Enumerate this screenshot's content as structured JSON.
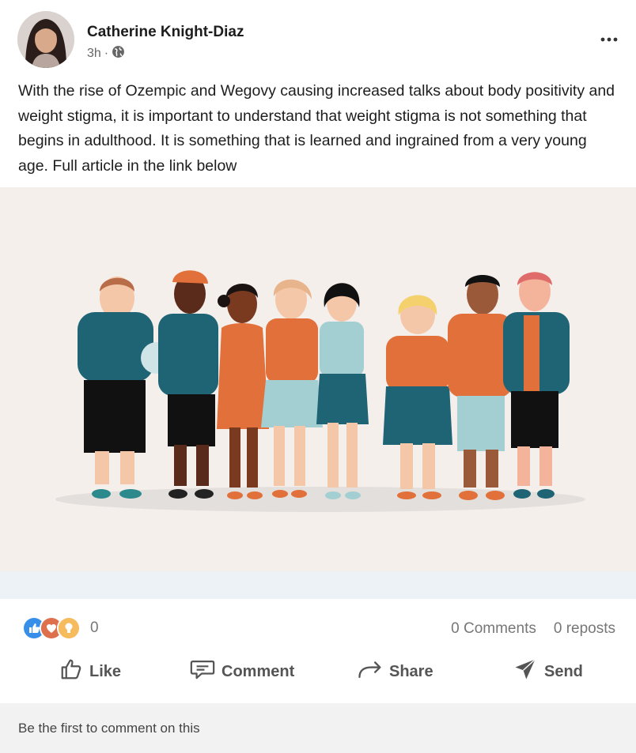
{
  "post": {
    "author": "Catherine Knight-Diaz",
    "time": "3h",
    "separator": "·",
    "visibility_icon": "globe-icon",
    "more_icon": "more-horizontal-icon",
    "text": "With the rise of Ozempic and Wegovy causing increased talks about body positivity and weight stigma, it is important to understand that weight stigma is not something that begins in adulthood. It is something that is learned and ingrained from a very young age. Full article in the link below"
  },
  "stats": {
    "reaction_icons": [
      "like-reaction-icon",
      "love-reaction-icon",
      "insightful-reaction-icon"
    ],
    "reaction_count": "0",
    "comments": "0 Comments",
    "reposts": "0 reposts"
  },
  "actions": {
    "like": "Like",
    "comment": "Comment",
    "share": "Share",
    "send": "Send"
  },
  "footer": {
    "text": "Be the first to comment on this"
  },
  "colors": {
    "image_bg": "#f5efec",
    "teal": "#1e6475",
    "orange": "#e2703a",
    "light_blue": "#a3cfd2"
  }
}
